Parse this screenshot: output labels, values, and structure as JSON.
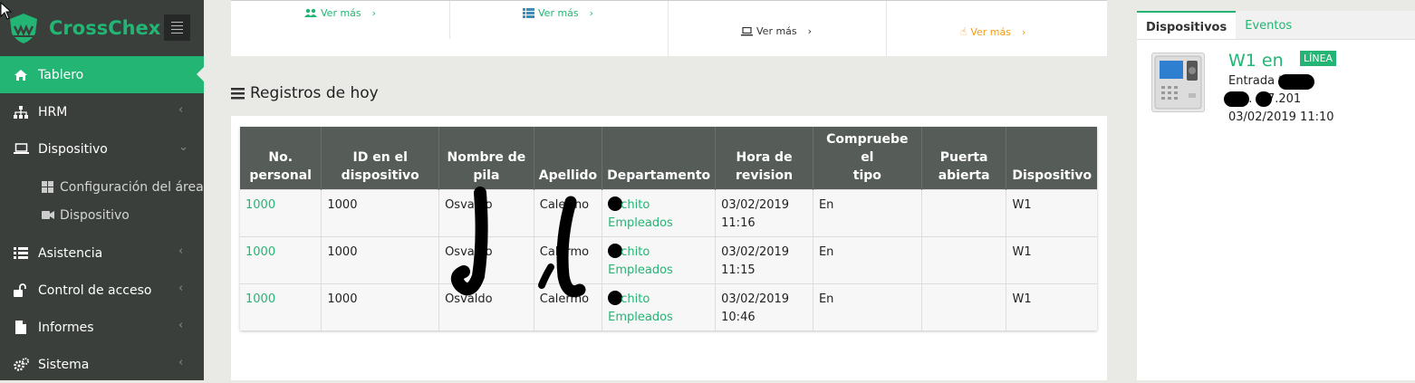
{
  "brand": {
    "name": "CrossChex"
  },
  "sidebar": {
    "items": [
      {
        "label": "Tablero",
        "icon": "home-icon"
      },
      {
        "label": "HRM",
        "icon": "sitemap-icon"
      },
      {
        "label": "Dispositivo",
        "icon": "laptop-icon"
      },
      {
        "label": "Asistencia",
        "icon": "list-icon"
      },
      {
        "label": "Control de acceso",
        "icon": "unlock-icon"
      },
      {
        "label": "Informes",
        "icon": "file-icon"
      },
      {
        "label": "Sistema",
        "icon": "gears-icon"
      }
    ],
    "sub_items": [
      {
        "label": "Configuración del área",
        "icon": "grid-icon"
      },
      {
        "label": "Dispositivo",
        "icon": "video-camera-icon"
      }
    ]
  },
  "topcards": {
    "vermas": [
      "Ver más",
      "Ver más",
      "Ver más",
      "Ver más"
    ]
  },
  "section": {
    "title": "Registros de hoy"
  },
  "table": {
    "headers": [
      [
        "No.",
        "personal"
      ],
      [
        "ID en el",
        "dispositivo"
      ],
      [
        "Nombre de",
        "pila"
      ],
      [
        "Apellido"
      ],
      [
        "Departamento"
      ],
      [
        "Hora de",
        "revision"
      ],
      [
        "Compruebe el",
        "tipo"
      ],
      [
        "Puerta",
        "abierta"
      ],
      [
        "Dispositivo"
      ]
    ],
    "rows": [
      {
        "no": "1000",
        "id": "1000",
        "nombre": "Osvaldo",
        "apellido": "Calermo",
        "dept1": "chito",
        "dept2": "Empleados",
        "fecha": "03/02/2019",
        "hora": "11:16",
        "tipo": "En",
        "puerta": "",
        "dispositivo": "W1"
      },
      {
        "no": "1000",
        "id": "1000",
        "nombre": "Osvaldo",
        "apellido": "Calermo",
        "dept1": "chito",
        "dept2": "Empleados",
        "fecha": "03/02/2019",
        "hora": "11:15",
        "tipo": "En",
        "puerta": "",
        "dispositivo": "W1"
      },
      {
        "no": "1000",
        "id": "1000",
        "nombre": "Osvaldo",
        "apellido": "Calermo",
        "dept1": "chito",
        "dept2": "Empleados",
        "fecha": "03/02/2019",
        "hora": "10:46",
        "tipo": "En",
        "puerta": "",
        "dispositivo": "W1"
      }
    ]
  },
  "right_panel": {
    "tabs": [
      "Dispositivos",
      "Eventos"
    ],
    "device": {
      "title": "W1 en",
      "status": "LÍNEA",
      "line1": "Entrada to",
      "line2": "1. .77.201",
      "line3": "03/02/2019 11:10"
    }
  },
  "colors": {
    "accent": "#22b573",
    "sidebar": "#3a3f3c",
    "header": "#565d58"
  }
}
